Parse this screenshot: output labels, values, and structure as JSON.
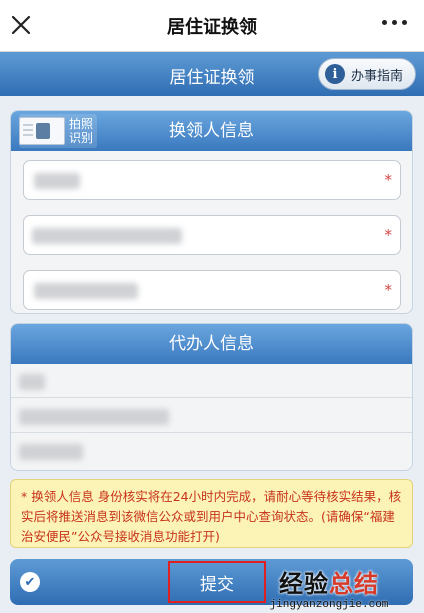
{
  "wechat_bar": {
    "title": "居住证换领",
    "close_icon": "close-icon",
    "more_icon": "more-icon"
  },
  "header": {
    "title": "居住证换领",
    "guide_label": "办事指南",
    "guide_icon": "info-icon",
    "guide_icon_glyph": "i"
  },
  "applicant_panel": {
    "title": "换领人信息",
    "scan_label_line1": "拍照",
    "scan_label_line2": "识别",
    "required_mark": "*"
  },
  "agent_panel": {
    "title": "代办人信息"
  },
  "notice": {
    "text": "* 换领人信息 身份核实将在24小时内完成，请耐心等待核实结果，核实后将推送消息到该微信公众或到用户中心查询状态。(请确保“福建治安便民”公众号接收消息功能打开)"
  },
  "footer": {
    "check_glyph": "✔",
    "submit_label": "提交"
  },
  "watermark": {
    "part1": "经验",
    "part2": "总结",
    "url": "jingyanzongjie.com"
  },
  "colors": {
    "header_blue": "#3a79bf",
    "required_red": "#d84646",
    "notice_bg": "#fbf4b6",
    "notice_text": "#c8321b",
    "submit_outline": "#e02020"
  }
}
